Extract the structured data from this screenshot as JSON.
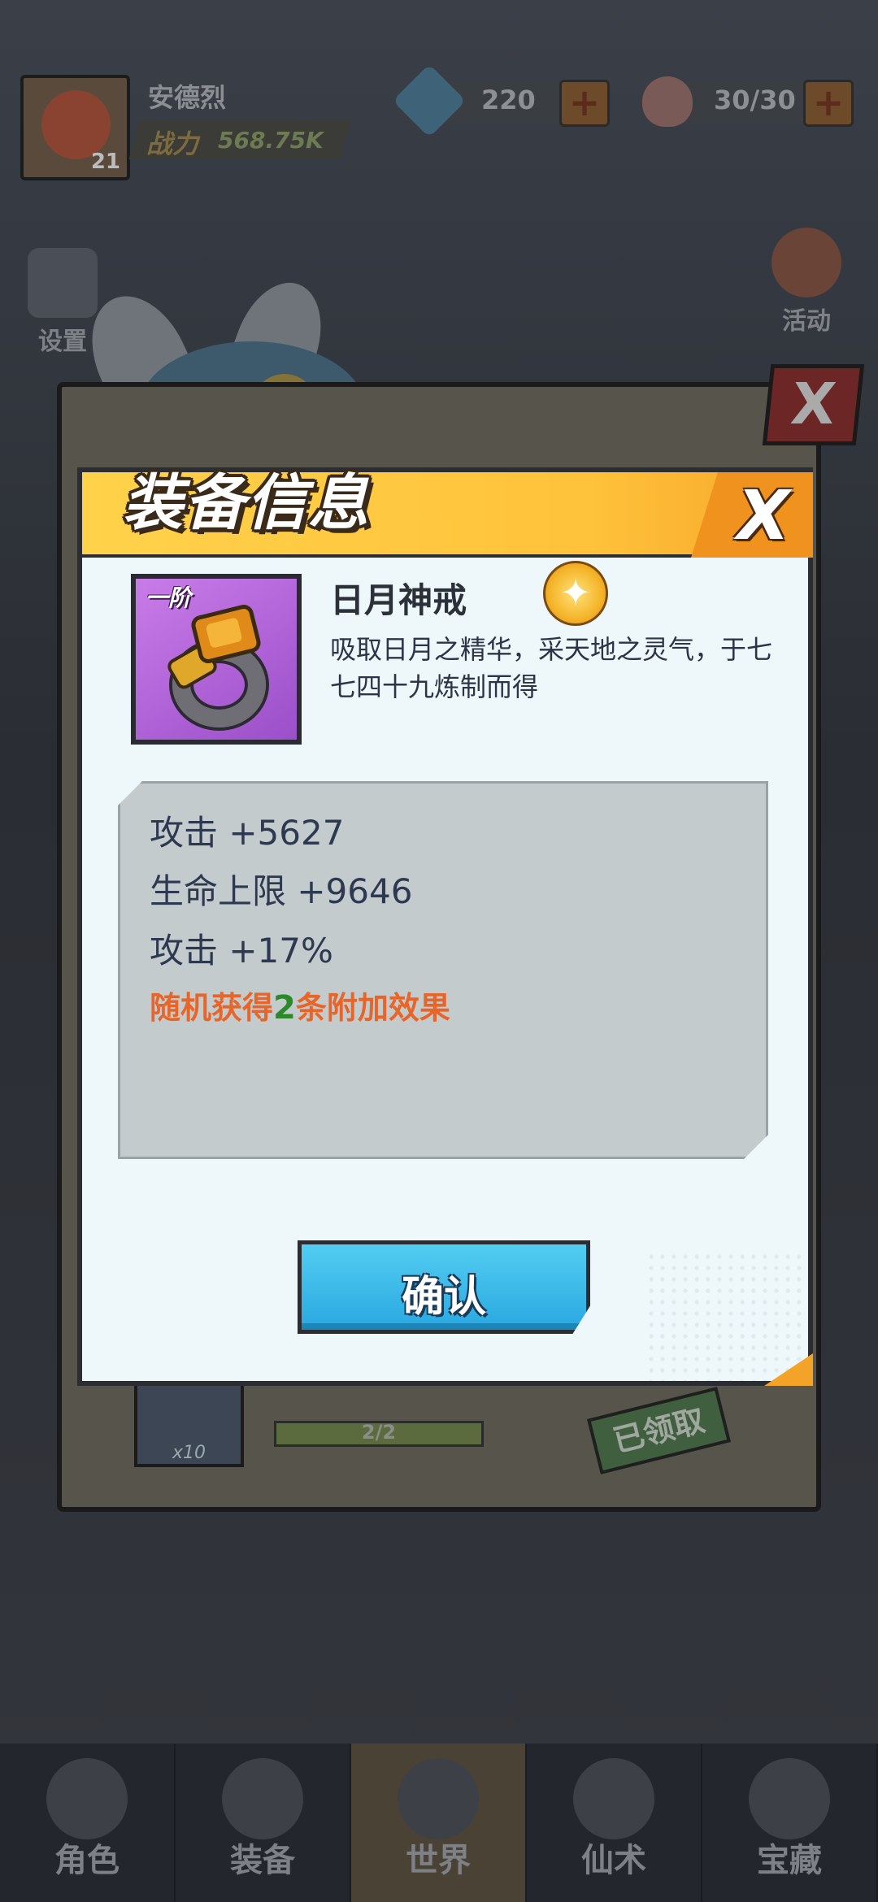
{
  "player": {
    "name": "安德烈",
    "level": "21",
    "power_label": "战力",
    "power_value": "568.75K"
  },
  "resources": {
    "gems": "220",
    "energy": "30/30",
    "plus": "+"
  },
  "side_buttons": {
    "settings": "设置",
    "activity": "活动"
  },
  "background_panel": {
    "close": "X",
    "item_count": "x10",
    "progress": "2/2",
    "claimed": "已领取"
  },
  "bottom_nav": [
    {
      "label": "角色"
    },
    {
      "label": "装备"
    },
    {
      "label": "世界"
    },
    {
      "label": "仙术"
    },
    {
      "label": "宝藏"
    }
  ],
  "modal": {
    "title": "装备信息",
    "close": "X",
    "item": {
      "tier": "一阶",
      "name": "日月神戒",
      "description": "吸取日月之精华，采天地之灵气，于七七四十九炼制而得"
    },
    "stats": [
      "攻击 +5627",
      "生命上限 +9646",
      "攻击 +17%"
    ],
    "random_effect": {
      "prefix": "随机获得",
      "count": "2",
      "suffix": "条附加效果"
    },
    "confirm": "确认"
  },
  "colors": {
    "header": "#ffc23a",
    "item_frame": "#b065dc",
    "random_text": "#e8652a",
    "random_count": "#2a8a2a",
    "confirm_button": "#2aa8e0"
  }
}
